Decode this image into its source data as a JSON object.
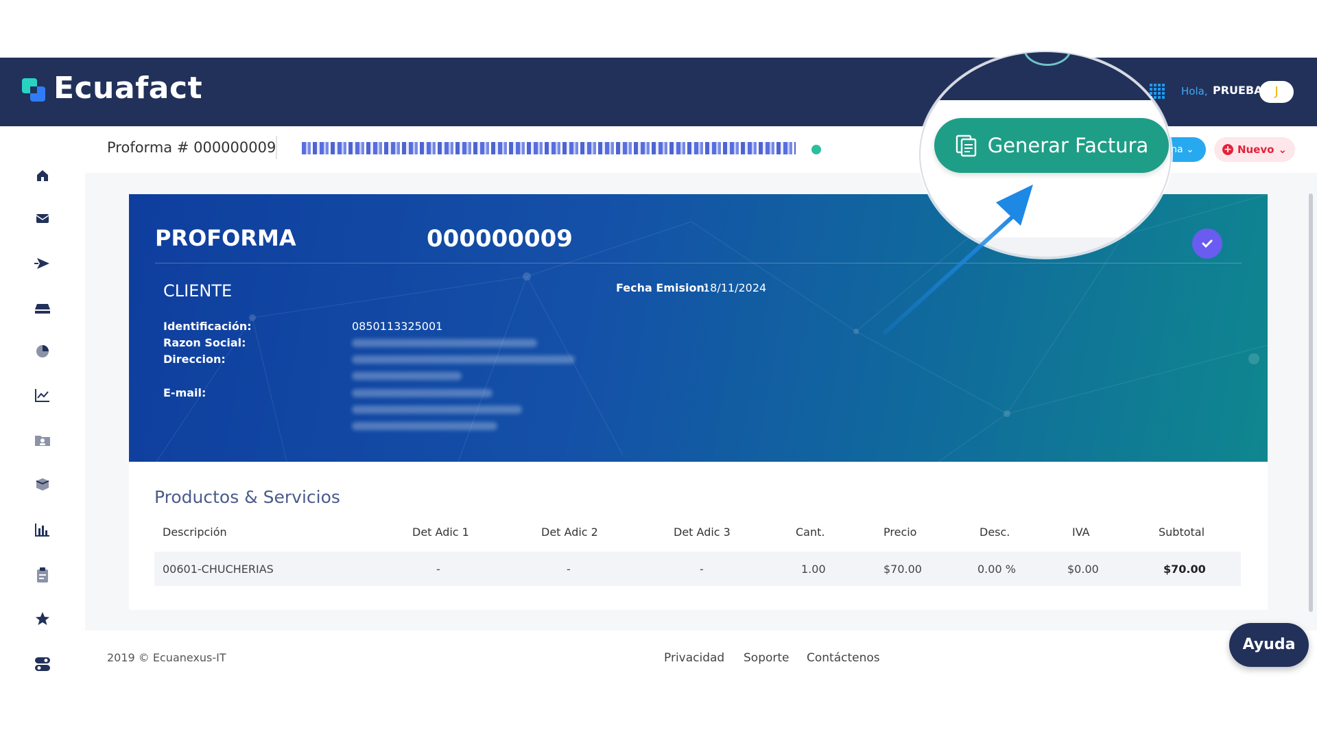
{
  "brand": {
    "name": "Ecuafact"
  },
  "header": {
    "greeting": "Hola,",
    "username": "PRUEBA",
    "avatar_initial": "J"
  },
  "sidebar": {
    "items": [
      {
        "icon": "home-icon"
      },
      {
        "icon": "mail-icon"
      },
      {
        "icon": "send-icon"
      },
      {
        "icon": "inbox-icon"
      },
      {
        "icon": "pie-chart-icon"
      },
      {
        "icon": "line-chart-icon"
      },
      {
        "icon": "contacts-folder-icon"
      },
      {
        "icon": "box-icon"
      },
      {
        "icon": "bar-chart-icon"
      },
      {
        "icon": "clipboard-icon"
      },
      {
        "icon": "star-icon"
      },
      {
        "icon": "toggle-icon"
      }
    ]
  },
  "subheader": {
    "title": "Proforma # 000000009"
  },
  "actions": {
    "generate_label": "Generar Factura",
    "options_label": "na",
    "new_label": "Nuevo"
  },
  "card": {
    "label": "PROFORMA",
    "number": "000000009",
    "client_heading": "CLIENTE",
    "date_label": "Fecha Emision:",
    "date_value": "18/11/2024",
    "fields": {
      "id_label": "Identificación:",
      "id_value": "0850113325001",
      "name_label": "Razon Social:",
      "address_label": "Direccion:",
      "email_label": "E-mail:"
    }
  },
  "products": {
    "title": "Productos & Servicios",
    "columns": [
      "Descripción",
      "Det Adic 1",
      "Det Adic 2",
      "Det Adic 3",
      "Cant.",
      "Precio",
      "Desc.",
      "IVA",
      "Subtotal"
    ],
    "rows": [
      [
        "00601-CHUCHERIAS",
        "-",
        "-",
        "-",
        "1.00",
        "$70.00",
        "0.00 %",
        "$0.00",
        "$70.00"
      ]
    ]
  },
  "footer": {
    "copyright": "2019 © Ecuanexus-IT",
    "links": [
      "Privacidad",
      "Soporte",
      "Contáctenos"
    ]
  },
  "help": {
    "label": "Ayuda"
  },
  "colors": {
    "header_bg": "#22315a",
    "primary_teal": "#1f9e87",
    "danger": "#e3213a",
    "info": "#27a9f0",
    "card_blue": "#1450a8"
  }
}
